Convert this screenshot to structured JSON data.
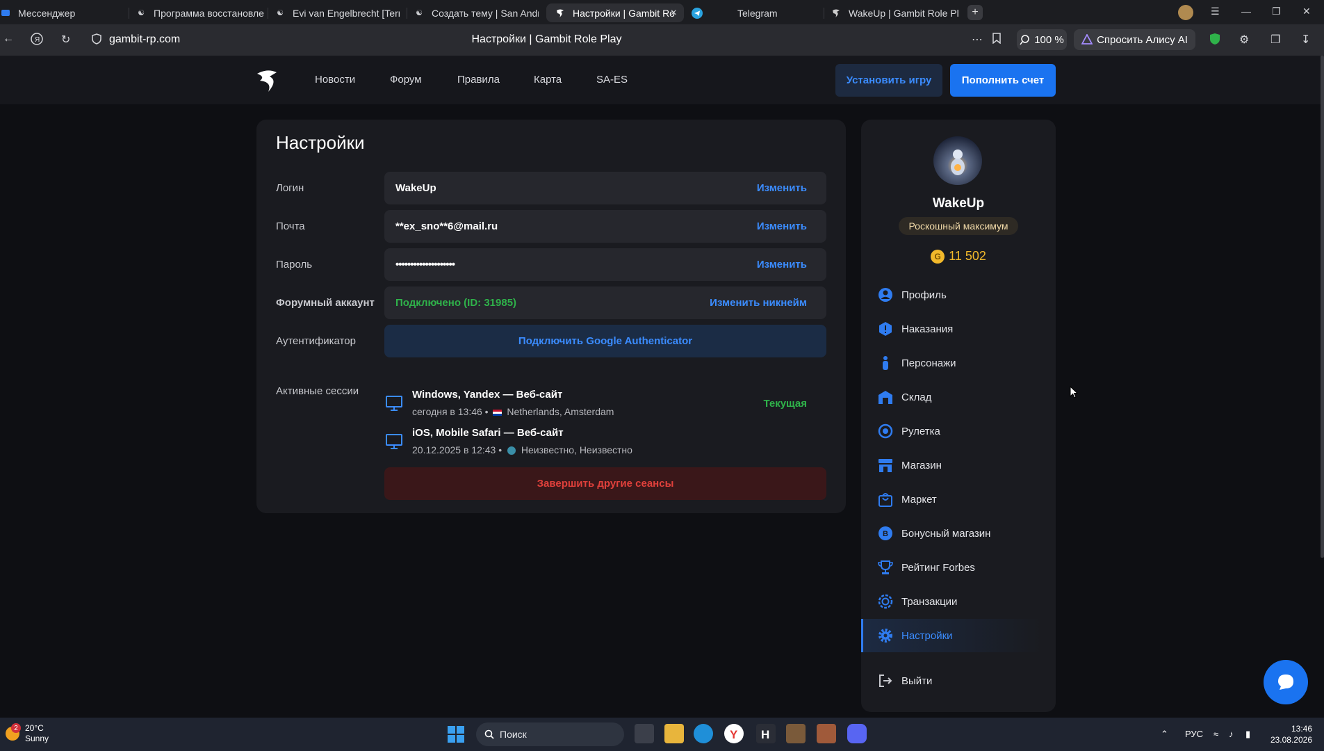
{
  "browser": {
    "tabs": [
      {
        "label": "Мессенджер"
      },
      {
        "label": "Программа восстановле"
      },
      {
        "label": "Evi van Engelbrecht [Terre"
      },
      {
        "label": "Создать тему | San Andre"
      },
      {
        "label": "Настройки | Gambit Ro",
        "active": true
      },
      {
        "label": "Telegram"
      },
      {
        "label": "WakeUp | Gambit Role Pla"
      }
    ],
    "url": "gambit-rp.com",
    "page_title": "Настройки | Gambit Role Play",
    "zoom": "100 %",
    "alice_label": "Спросить Алису AI"
  },
  "header": {
    "nav": [
      "Новости",
      "Форум",
      "Правила",
      "Карта",
      "SA-ES"
    ],
    "install_label": "Установить игру",
    "topup_label": "Пополнить счет"
  },
  "settings": {
    "title": "Настройки",
    "login_label": "Логин",
    "login_value": "WakeUp",
    "email_label": "Почта",
    "email_value": "**ex_sno**6@mail.ru",
    "password_label": "Пароль",
    "password_value": "••••••••••••••••••••",
    "change_label": "Изменить",
    "forum_label": "Форумный аккаунт",
    "forum_value": "Подключено (ID: 31985)",
    "change_nick_label": "Изменить никнейм",
    "auth_label": "Аутентификатор",
    "auth_button": "Подключить Google Authenticator",
    "sessions_label": "Активные сессии",
    "sessions": [
      {
        "title": "Windows, Yandex — Веб-сайт",
        "date": "сегодня в 13:46 •",
        "location": "Netherlands, Amsterdam",
        "current": "Текущая"
      },
      {
        "title": "iOS, Mobile Safari — Веб-сайт",
        "date": "20.12.2025 в 12:43 •",
        "location": "Неизвестно, Неизвестно"
      }
    ],
    "end_sessions": "Завершить другие сеансы"
  },
  "profile": {
    "username": "WakeUp",
    "rank": "Роскошный максимум",
    "balance": "11 502",
    "coin_symbol": "G",
    "menu": [
      {
        "label": "Профиль",
        "icon": "user-icon"
      },
      {
        "label": "Наказания",
        "icon": "warning-icon"
      },
      {
        "label": "Персонажи",
        "icon": "person-icon"
      },
      {
        "label": "Склад",
        "icon": "warehouse-icon"
      },
      {
        "label": "Рулетка",
        "icon": "roulette-icon"
      },
      {
        "label": "Магазин",
        "icon": "shop-icon"
      },
      {
        "label": "Маркет",
        "icon": "bag-icon"
      },
      {
        "label": "Бонусный магазин",
        "icon": "bonus-icon"
      },
      {
        "label": "Рейтинг Forbes",
        "icon": "trophy-icon"
      },
      {
        "label": "Транзакции",
        "icon": "transactions-icon"
      },
      {
        "label": "Настройки",
        "icon": "gear-icon",
        "active": true
      }
    ],
    "logout": "Выйти"
  },
  "taskbar": {
    "temp": "20°C",
    "weather": "Sunny",
    "weather_badge": "2",
    "search": "Поиск",
    "lang": "РУС",
    "time": "13:46",
    "date": "23.08.2026"
  },
  "colors": {
    "accent": "#1a73f0",
    "link": "#3b8cff",
    "success": "#2fb24a",
    "danger": "#e0403b",
    "gold": "#f2b92b"
  }
}
